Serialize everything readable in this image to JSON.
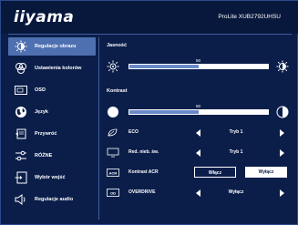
{
  "header": {
    "logo": "iiyama",
    "model": "ProLite XUB2792UHSU"
  },
  "sidebar": {
    "items": [
      {
        "label": "Regulacje obrazu",
        "icon": "sun-icon",
        "active": true
      },
      {
        "label": "Ustawienia kolorów",
        "icon": "color-settings-icon",
        "active": false
      },
      {
        "label": "OSD",
        "icon": "osd-icon",
        "active": false
      },
      {
        "label": "Język",
        "icon": "globe-icon",
        "active": false
      },
      {
        "label": "Przywróć",
        "icon": "recall-icon",
        "active": false
      },
      {
        "label": "RÓŻNE",
        "icon": "sliders-icon",
        "active": false
      },
      {
        "label": "Wybór wejść",
        "icon": "input-select-icon",
        "active": false
      },
      {
        "label": "Regulacje audio",
        "icon": "speaker-icon",
        "active": false
      }
    ]
  },
  "main": {
    "brightness": {
      "title": "Jasność",
      "value": 50
    },
    "contrast": {
      "title": "Kontrast",
      "value": 50
    },
    "eco": {
      "label": "ECO",
      "value": "Tryb 1"
    },
    "blue_light": {
      "label": "Red. nieb. św.",
      "value": "Tryb 1"
    },
    "acr": {
      "label": "Kontrast ACR",
      "on_label": "Włącz",
      "off_label": "Wyłącz",
      "selected": "off"
    },
    "overdrive": {
      "label": "OVERDRIVE",
      "value": "Wyłącz"
    }
  },
  "colors": {
    "background": "#0b1e4a",
    "active_item": "#4e6fb0",
    "slider_fill": "#6a8ac8"
  }
}
